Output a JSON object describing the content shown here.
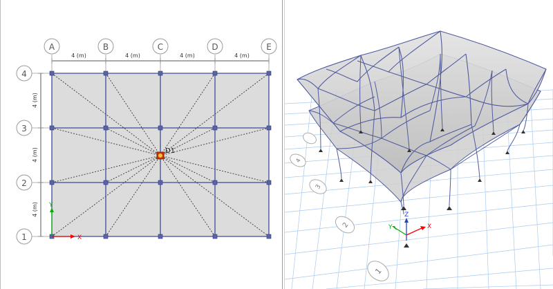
{
  "plan_view": {
    "grid_x_labels": [
      "A",
      "B",
      "C",
      "D",
      "E"
    ],
    "grid_y_labels": [
      "4",
      "3",
      "2",
      "1"
    ],
    "x_spacing_labels": [
      "4 (m)",
      "4 (m)",
      "4 (m)",
      "4 (m)"
    ],
    "y_spacing_labels": [
      "4 (m)",
      "4 (m)",
      "4 (m)"
    ],
    "diaphragm_label": "D1",
    "axis_x_label": "X",
    "axis_y_label": "Y",
    "colors": {
      "slab_fill": "#dcdcdc",
      "beam_line": "#3d4a99",
      "column_node": "#5a64a8",
      "bubble_stroke": "#9a9a9a",
      "diaphragm_center": "#cc3300",
      "axis_x": "#ff0000",
      "axis_y": "#00b000",
      "dotted_line": "#333333"
    }
  },
  "model_3d_view": {
    "axis_labels": [
      "X",
      "Y",
      "Z"
    ],
    "grid_bubble_labels": [
      "1",
      "2",
      "3",
      "4"
    ],
    "colors": {
      "deformed_frame": "#4f5a9e",
      "slab_fill": "#c9c9c9",
      "ground_grid": "#a9c9ee"
    }
  }
}
